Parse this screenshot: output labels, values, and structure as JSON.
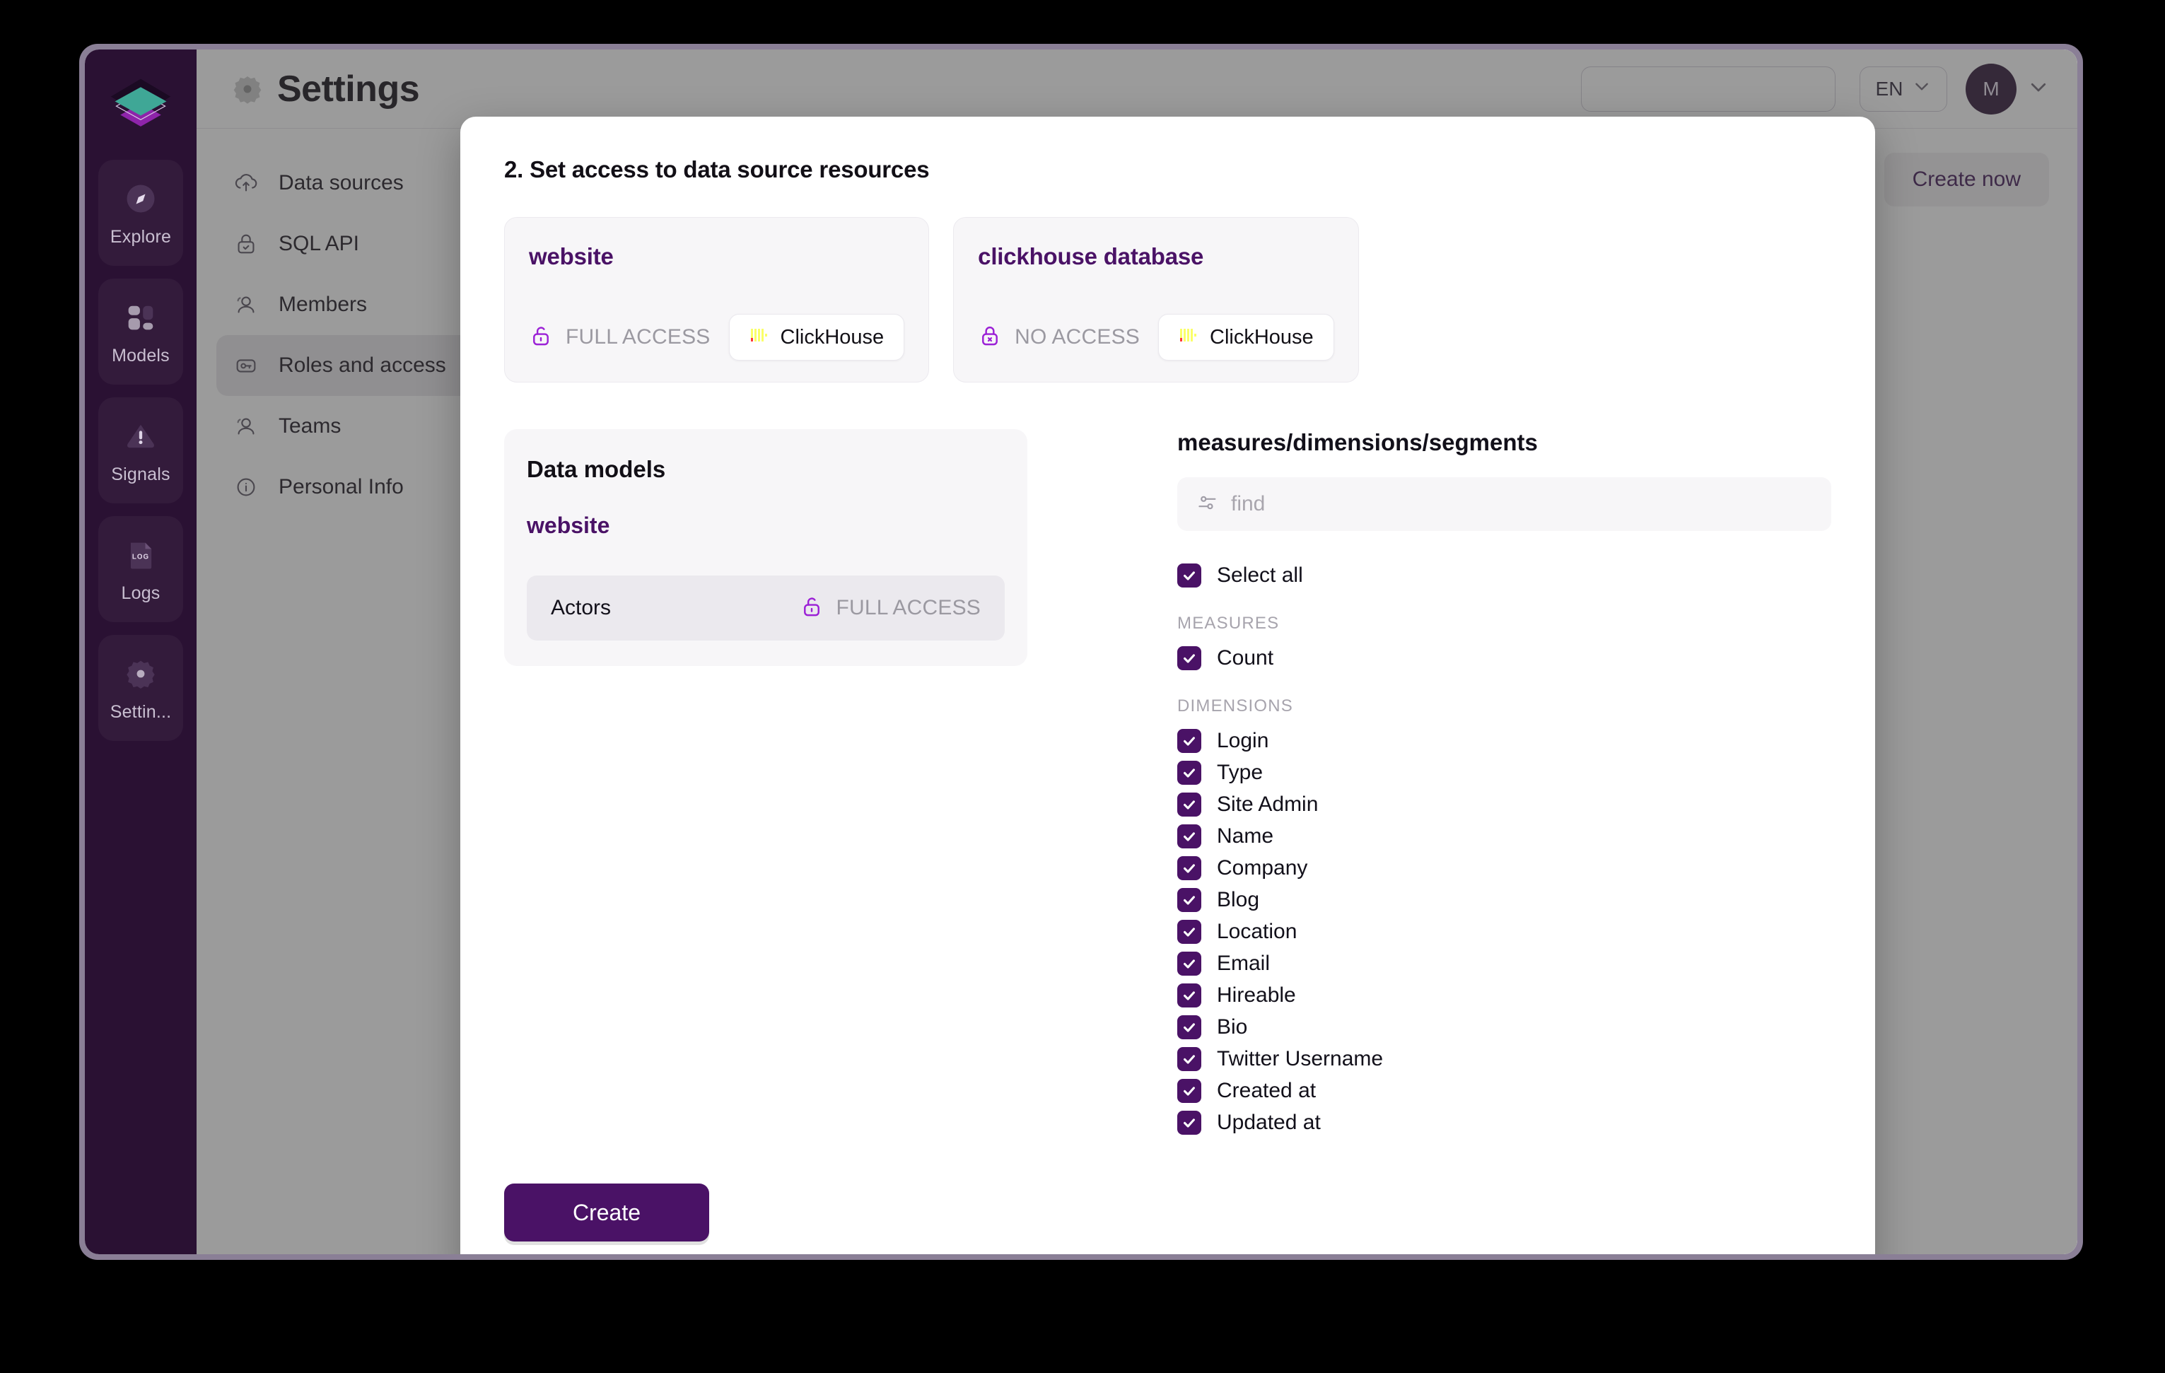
{
  "rail": {
    "logo_icon": "stacked-layers-logo",
    "items": [
      {
        "label": "Explore",
        "icon": "compass-icon"
      },
      {
        "label": "Models",
        "icon": "blocks-icon"
      },
      {
        "label": "Signals",
        "icon": "alert-triangle-icon"
      },
      {
        "label": "Logs",
        "icon": "log-file-icon"
      },
      {
        "label": "Settin...",
        "icon": "gear-icon"
      }
    ]
  },
  "topbar": {
    "gear_icon": "gear-icon",
    "title": "Settings",
    "search_placeholder": "",
    "language": "EN",
    "language_caret_icon": "chevron-down-icon",
    "avatar_initial": "M",
    "avatar_caret_icon": "chevron-down-icon"
  },
  "settings_nav": {
    "items": [
      {
        "label": "Data sources",
        "icon": "cloud-upload-icon",
        "active": false
      },
      {
        "label": "SQL API",
        "icon": "lock-check-icon",
        "active": false
      },
      {
        "label": "Members",
        "icon": "users-icon",
        "active": false
      },
      {
        "label": "Roles and access",
        "icon": "key-card-icon",
        "active": true
      },
      {
        "label": "Teams",
        "icon": "users-icon",
        "active": false
      },
      {
        "label": "Personal Info",
        "icon": "info-circle-icon",
        "active": false
      }
    ]
  },
  "page_actions": {
    "create_now_label": "Create now"
  },
  "modal": {
    "step_title": "2. Set access to data source resources",
    "data_sources": [
      {
        "name": "website",
        "access_label": "FULL ACCESS",
        "access_icon": "unlock-icon",
        "connector_label": "ClickHouse",
        "connector_icon": "clickhouse-logo"
      },
      {
        "name": "clickhouse database",
        "access_label": "NO ACCESS",
        "access_icon": "lock-x-icon",
        "connector_label": "ClickHouse",
        "connector_icon": "clickhouse-logo"
      }
    ],
    "models_panel": {
      "title": "Data models",
      "source_name": "website",
      "rows": [
        {
          "name": "Actors",
          "access_label": "FULL ACCESS",
          "access_icon": "unlock-icon"
        }
      ]
    },
    "fields_panel": {
      "title": "measures/dimensions/segments",
      "find_placeholder": "find",
      "find_value": "",
      "find_icon": "filter-sliders-icon",
      "select_all_label": "Select all",
      "select_all_checked": true,
      "groups": [
        {
          "heading": "MEASURES",
          "items": [
            {
              "label": "Count",
              "checked": true
            }
          ]
        },
        {
          "heading": "DIMENSIONS",
          "items": [
            {
              "label": "Login",
              "checked": true
            },
            {
              "label": "Type",
              "checked": true
            },
            {
              "label": "Site Admin",
              "checked": true
            },
            {
              "label": "Name",
              "checked": true
            },
            {
              "label": "Company",
              "checked": true
            },
            {
              "label": "Blog",
              "checked": true
            },
            {
              "label": "Location",
              "checked": true
            },
            {
              "label": "Email",
              "checked": true
            },
            {
              "label": "Hireable",
              "checked": true
            },
            {
              "label": "Bio",
              "checked": true
            },
            {
              "label": "Twitter Username",
              "checked": true
            },
            {
              "label": "Created at",
              "checked": true
            },
            {
              "label": "Updated at",
              "checked": true
            }
          ]
        }
      ]
    },
    "create_label": "Create"
  },
  "colors": {
    "brand_purple": "#4a1266",
    "rail_bg": "#2a1133",
    "clickhouse_yellow": "#faff69",
    "clickhouse_red": "#ff3939",
    "logo_teal": "#3fa796"
  }
}
